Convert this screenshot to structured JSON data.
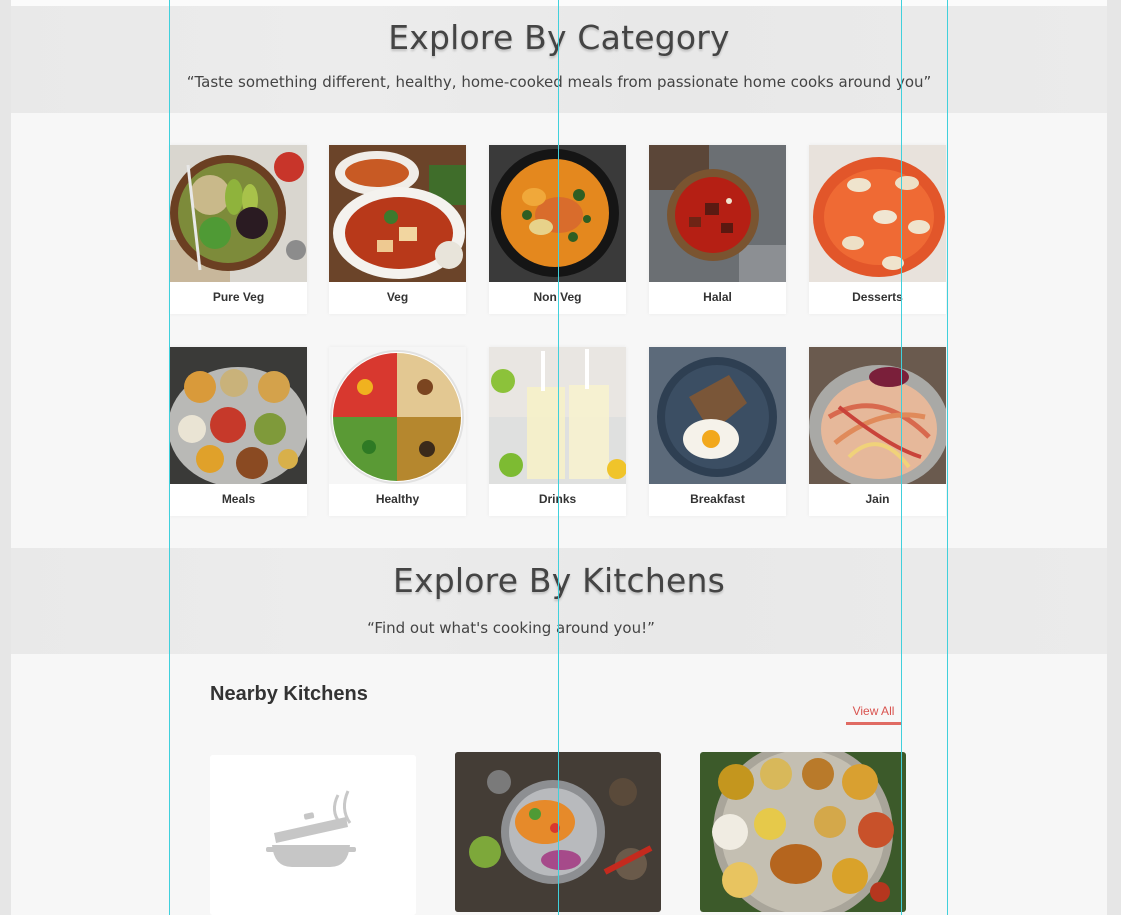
{
  "category_section": {
    "title": "Explore By Category",
    "subtitle": "“Taste something different, healthy, home-cooked meals from passionate home cooks around you”"
  },
  "categories": [
    {
      "label": "Pure Veg",
      "icon": "salad-bowl-image"
    },
    {
      "label": "Veg",
      "icon": "paneer-curry-image"
    },
    {
      "label": "Non Veg",
      "icon": "chicken-curry-image"
    },
    {
      "label": "Halal",
      "icon": "mutton-curry-image"
    },
    {
      "label": "Desserts",
      "icon": "halwa-image"
    },
    {
      "label": "Meals",
      "icon": "thali-image"
    },
    {
      "label": "Healthy",
      "icon": "healthy-plate-image"
    },
    {
      "label": "Drinks",
      "icon": "lemonade-image"
    },
    {
      "label": "Breakfast",
      "icon": "egg-toast-image"
    },
    {
      "label": "Jain",
      "icon": "noodles-image"
    }
  ],
  "kitchen_section": {
    "title": "Explore By Kitchens",
    "subtitle": "“Find out what's cooking around you!”"
  },
  "nearby": {
    "title": "Nearby Kitchens",
    "view_all": "View All"
  },
  "kitchens": [
    {
      "icon": "cooking-pot-placeholder-icon"
    },
    {
      "icon": "spice-platter-image"
    },
    {
      "icon": "thali-platter-image"
    }
  ],
  "colors": {
    "accent": "#d9534f",
    "guide_line": "#40d0dc",
    "page_bg": "#f7f7f7"
  }
}
